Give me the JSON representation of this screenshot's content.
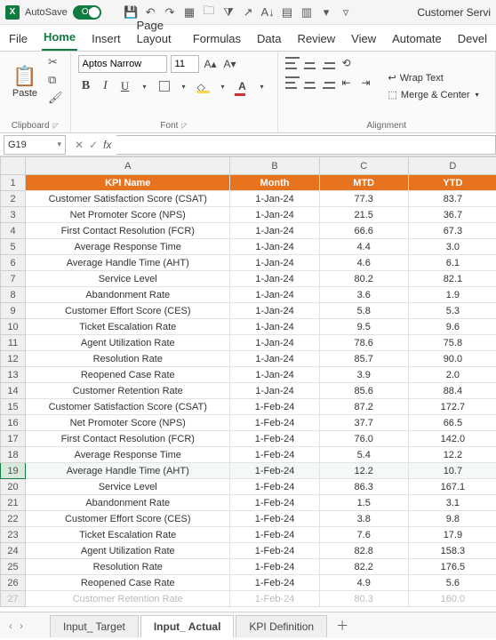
{
  "titlebar": {
    "autosave_label": "AutoSave",
    "autosave_state": "On",
    "doc_title": "Customer Servi"
  },
  "ribbon_tabs": [
    "File",
    "Home",
    "Insert",
    "Page Layout",
    "Formulas",
    "Data",
    "Review",
    "View",
    "Automate",
    "Devel"
  ],
  "ribbon_active_tab": "Home",
  "clipboard": {
    "paste_label": "Paste",
    "group_label": "Clipboard"
  },
  "font": {
    "name": "Aptos Narrow",
    "size": "11",
    "group_label": "Font"
  },
  "alignment": {
    "wrap_label": "Wrap Text",
    "merge_label": "Merge & Center",
    "group_label": "Alignment"
  },
  "namebox": "G19",
  "columns": [
    "A",
    "B",
    "C",
    "D"
  ],
  "header_row": [
    "KPI Name",
    "Month",
    "MTD",
    "YTD"
  ],
  "rows": [
    {
      "n": 2,
      "a": "Customer Satisfaction Score (CSAT)",
      "b": "1-Jan-24",
      "c": "77.3",
      "d": "83.7"
    },
    {
      "n": 3,
      "a": "Net Promoter Score (NPS)",
      "b": "1-Jan-24",
      "c": "21.5",
      "d": "36.7"
    },
    {
      "n": 4,
      "a": "First Contact Resolution (FCR)",
      "b": "1-Jan-24",
      "c": "66.6",
      "d": "67.3"
    },
    {
      "n": 5,
      "a": "Average Response Time",
      "b": "1-Jan-24",
      "c": "4.4",
      "d": "3.0"
    },
    {
      "n": 6,
      "a": "Average Handle Time (AHT)",
      "b": "1-Jan-24",
      "c": "4.6",
      "d": "6.1"
    },
    {
      "n": 7,
      "a": "Service Level",
      "b": "1-Jan-24",
      "c": "80.2",
      "d": "82.1"
    },
    {
      "n": 8,
      "a": "Abandonment Rate",
      "b": "1-Jan-24",
      "c": "3.6",
      "d": "1.9"
    },
    {
      "n": 9,
      "a": "Customer Effort Score (CES)",
      "b": "1-Jan-24",
      "c": "5.8",
      "d": "5.3"
    },
    {
      "n": 10,
      "a": "Ticket Escalation Rate",
      "b": "1-Jan-24",
      "c": "9.5",
      "d": "9.6"
    },
    {
      "n": 11,
      "a": "Agent Utilization Rate",
      "b": "1-Jan-24",
      "c": "78.6",
      "d": "75.8"
    },
    {
      "n": 12,
      "a": "Resolution Rate",
      "b": "1-Jan-24",
      "c": "85.7",
      "d": "90.0"
    },
    {
      "n": 13,
      "a": "Reopened Case Rate",
      "b": "1-Jan-24",
      "c": "3.9",
      "d": "2.0"
    },
    {
      "n": 14,
      "a": "Customer Retention Rate",
      "b": "1-Jan-24",
      "c": "85.6",
      "d": "88.4"
    },
    {
      "n": 15,
      "a": "Customer Satisfaction Score (CSAT)",
      "b": "1-Feb-24",
      "c": "87.2",
      "d": "172.7"
    },
    {
      "n": 16,
      "a": "Net Promoter Score (NPS)",
      "b": "1-Feb-24",
      "c": "37.7",
      "d": "66.5"
    },
    {
      "n": 17,
      "a": "First Contact Resolution (FCR)",
      "b": "1-Feb-24",
      "c": "76.0",
      "d": "142.0"
    },
    {
      "n": 18,
      "a": "Average Response Time",
      "b": "1-Feb-24",
      "c": "5.4",
      "d": "12.2"
    },
    {
      "n": 19,
      "a": "Average Handle Time (AHT)",
      "b": "1-Feb-24",
      "c": "12.2",
      "d": "10.7",
      "sel": true
    },
    {
      "n": 20,
      "a": "Service Level",
      "b": "1-Feb-24",
      "c": "86.3",
      "d": "167.1"
    },
    {
      "n": 21,
      "a": "Abandonment Rate",
      "b": "1-Feb-24",
      "c": "1.5",
      "d": "3.1"
    },
    {
      "n": 22,
      "a": "Customer Effort Score (CES)",
      "b": "1-Feb-24",
      "c": "3.8",
      "d": "9.8"
    },
    {
      "n": 23,
      "a": "Ticket Escalation Rate",
      "b": "1-Feb-24",
      "c": "7.6",
      "d": "17.9"
    },
    {
      "n": 24,
      "a": "Agent Utilization Rate",
      "b": "1-Feb-24",
      "c": "82.8",
      "d": "158.3"
    },
    {
      "n": 25,
      "a": "Resolution Rate",
      "b": "1-Feb-24",
      "c": "82.2",
      "d": "176.5"
    },
    {
      "n": 26,
      "a": "Reopened Case Rate",
      "b": "1-Feb-24",
      "c": "4.9",
      "d": "5.6"
    }
  ],
  "cut_row": {
    "n": 27,
    "a": "Customer Retention Rate",
    "b": "1-Feb-24",
    "c": "80.3",
    "d": "160.0"
  },
  "sheets": [
    "Input_ Target",
    "Input_ Actual",
    "KPI Definition"
  ],
  "active_sheet": "Input_ Actual"
}
